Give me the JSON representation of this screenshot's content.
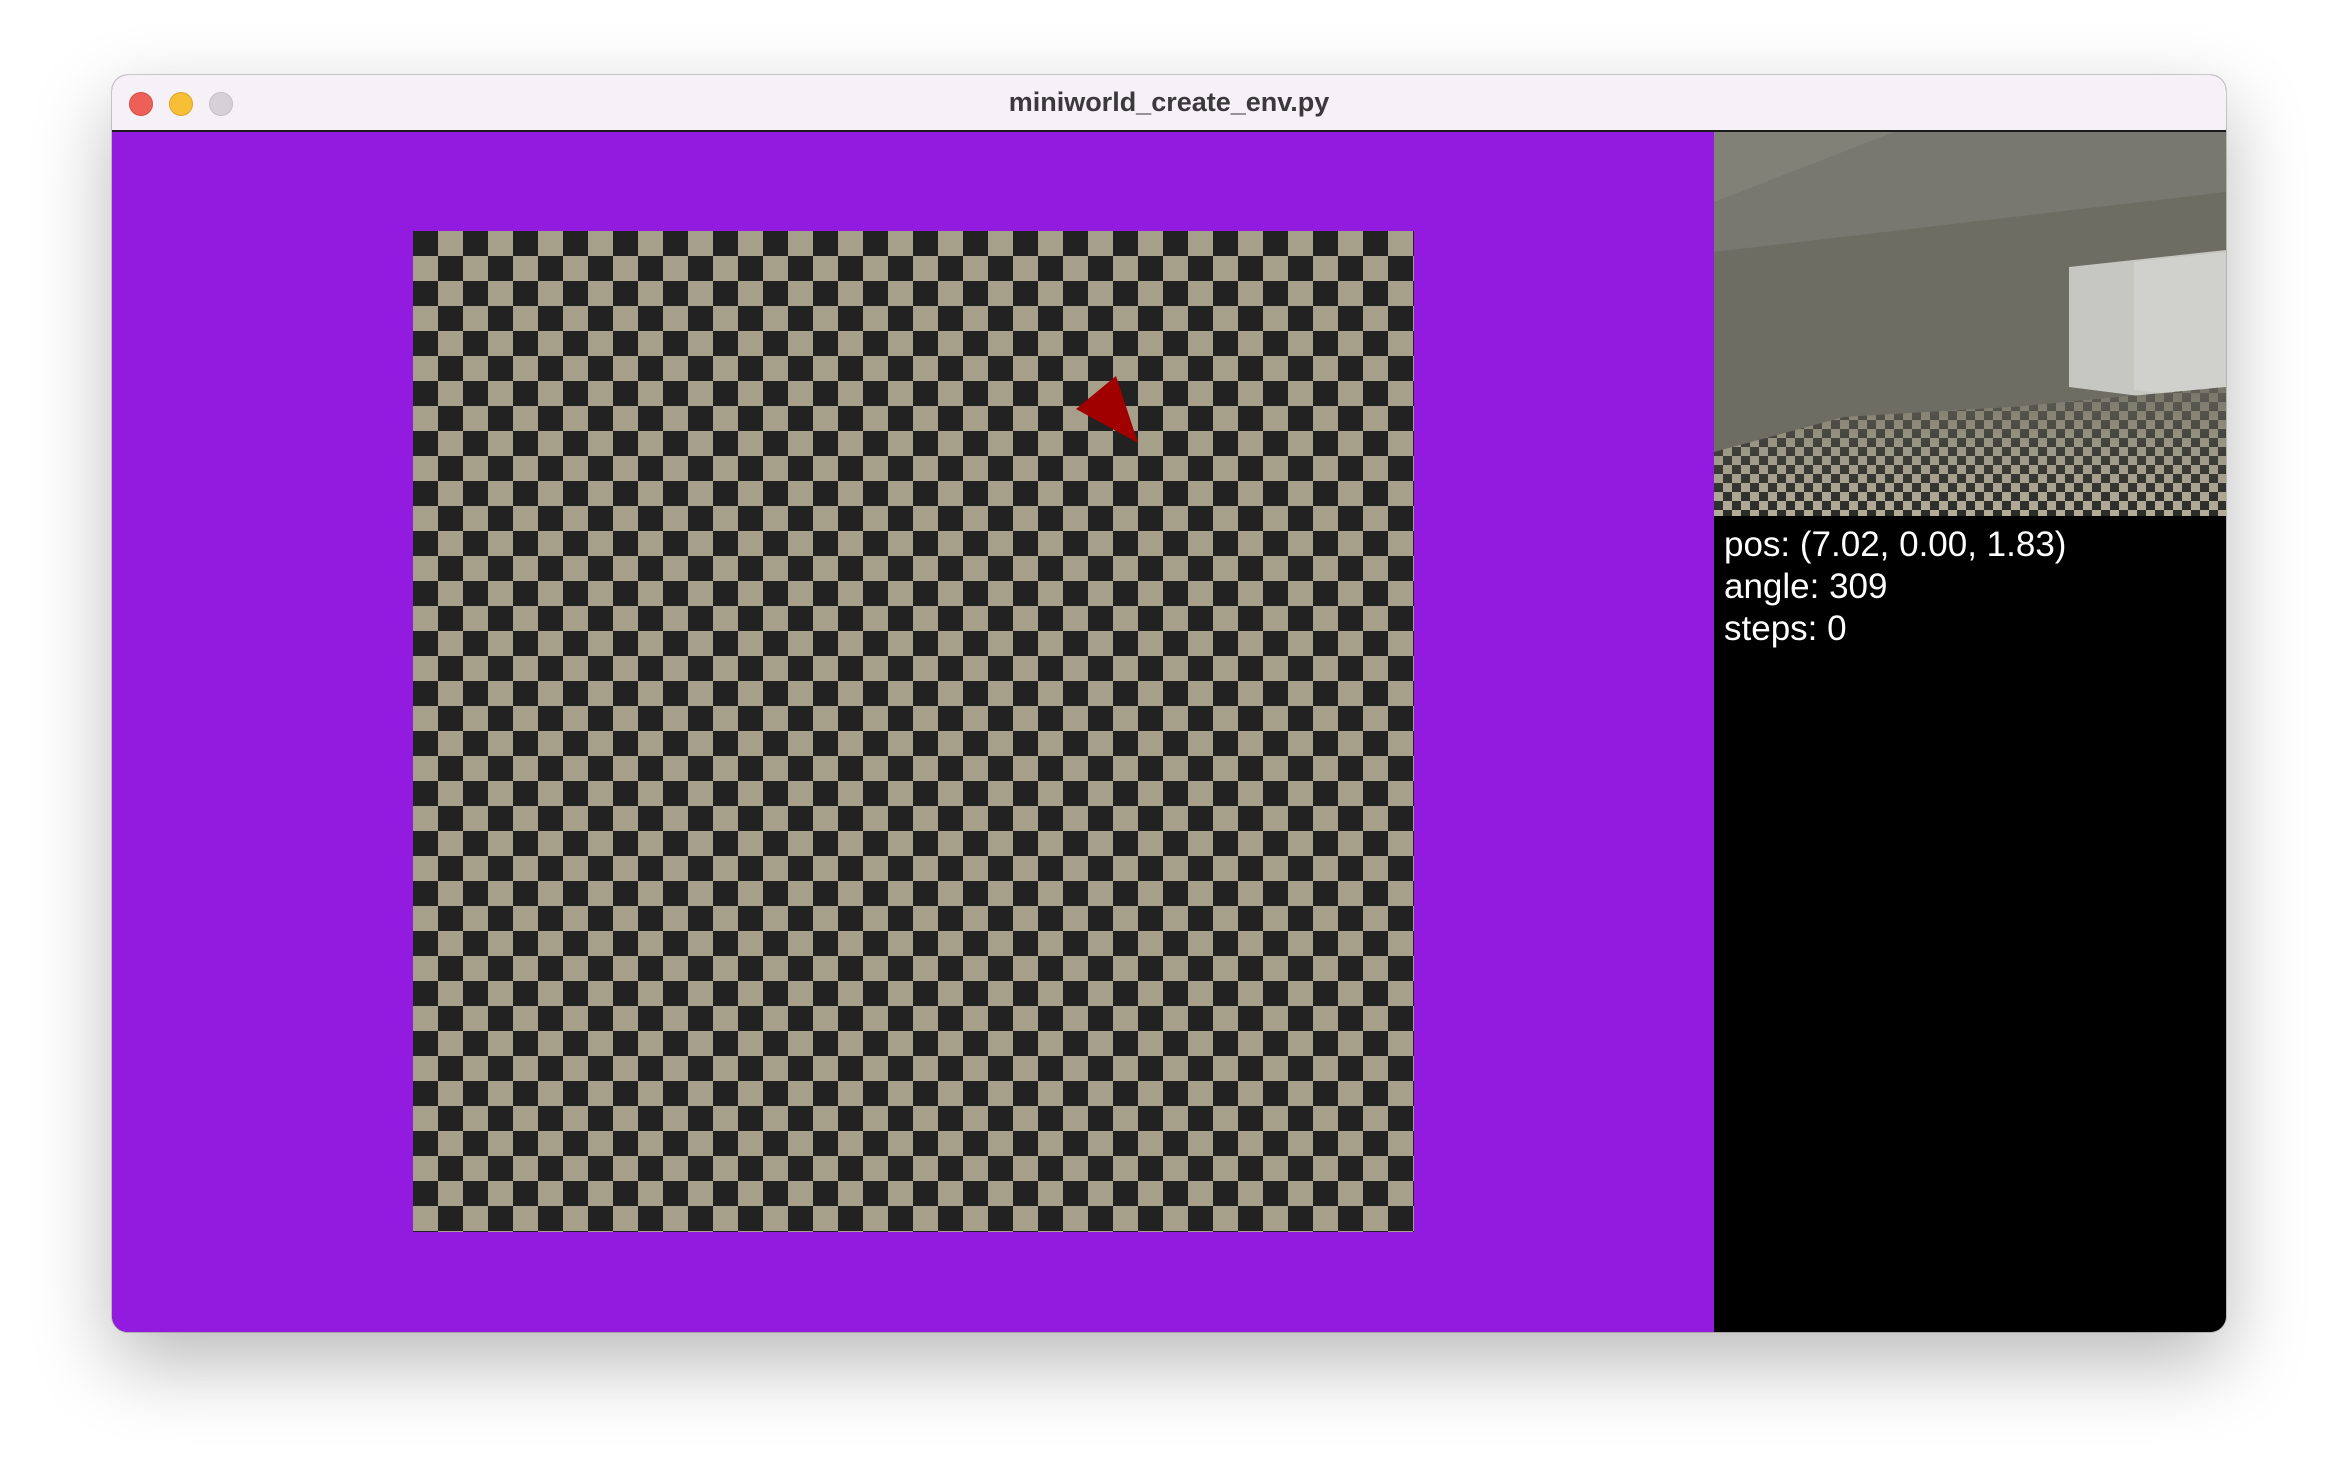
{
  "window": {
    "title": "miniworld_create_env.py"
  },
  "top_view": {
    "background_color": "#931be0",
    "floor_light_color": "#a6a08a",
    "floor_dark_color": "#212221",
    "agent_color": "#a00000"
  },
  "status": {
    "pos": "pos: (7.02, 0.00, 1.83)",
    "angle": "angle: 309",
    "steps": "steps: 0"
  },
  "icons": {
    "close": "close-circle-icon",
    "minimize": "minimize-circle-icon",
    "zoom": "zoom-circle-icon"
  }
}
